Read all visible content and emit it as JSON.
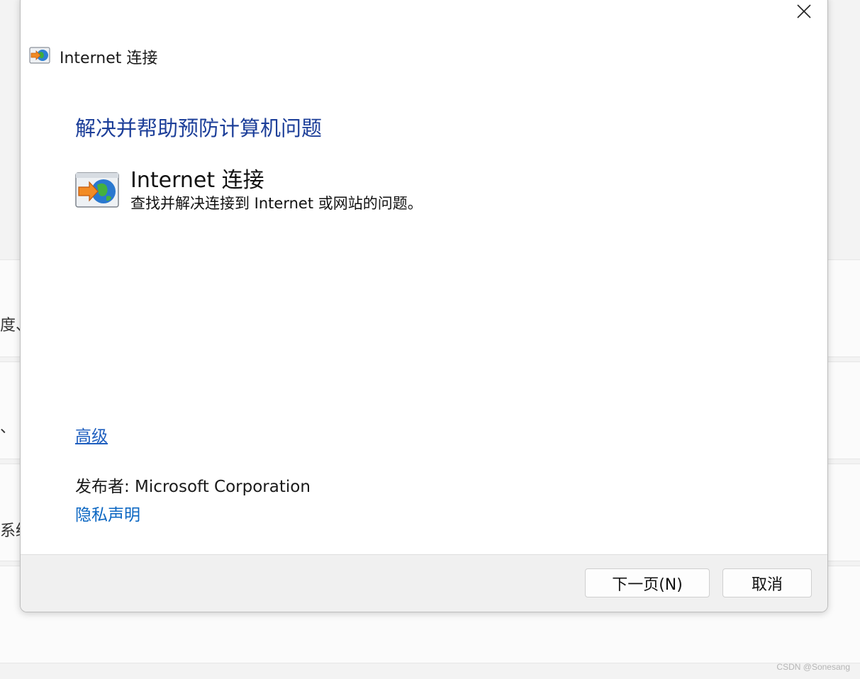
{
  "background": {
    "fragments": [
      "度、",
      "、 辑",
      "系统"
    ]
  },
  "dialog": {
    "title": "Internet 连接",
    "heading": "解决并帮助预防计算机问题",
    "task": {
      "title": "Internet 连接",
      "description": "查找并解决连接到 Internet 或网站的问题。",
      "icon": "internet-connection-icon"
    },
    "advanced_link": "高级",
    "publisher": "发布者:  Microsoft Corporation",
    "privacy_link": "隐私声明",
    "buttons": {
      "next": "下一页(N)",
      "cancel": "取消"
    }
  },
  "watermark": "CSDN @Sonesang",
  "colors": {
    "heading": "#1d3f99",
    "link": "#0a66c2",
    "footer": "#f0f0f0"
  }
}
